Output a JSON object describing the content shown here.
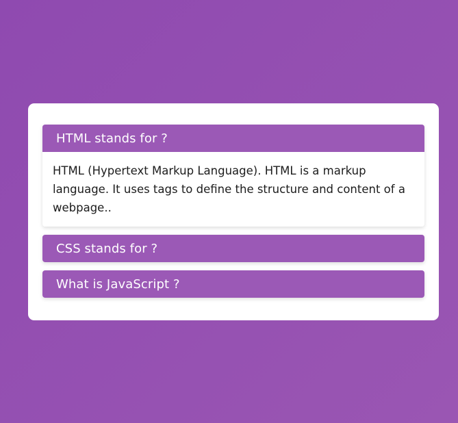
{
  "faq": {
    "items": [
      {
        "question": "HTML stands for ?",
        "answer": "HTML (Hypertext Markup Language). HTML is a markup language. It uses tags to define the structure and content of a webpage..",
        "expanded": true
      },
      {
        "question": "CSS stands for ?",
        "expanded": false
      },
      {
        "question": "What is JavaScript ?",
        "expanded": false
      }
    ]
  },
  "colors": {
    "background": "#9350b2",
    "header": "#9b59b6",
    "card": "#ffffff"
  }
}
